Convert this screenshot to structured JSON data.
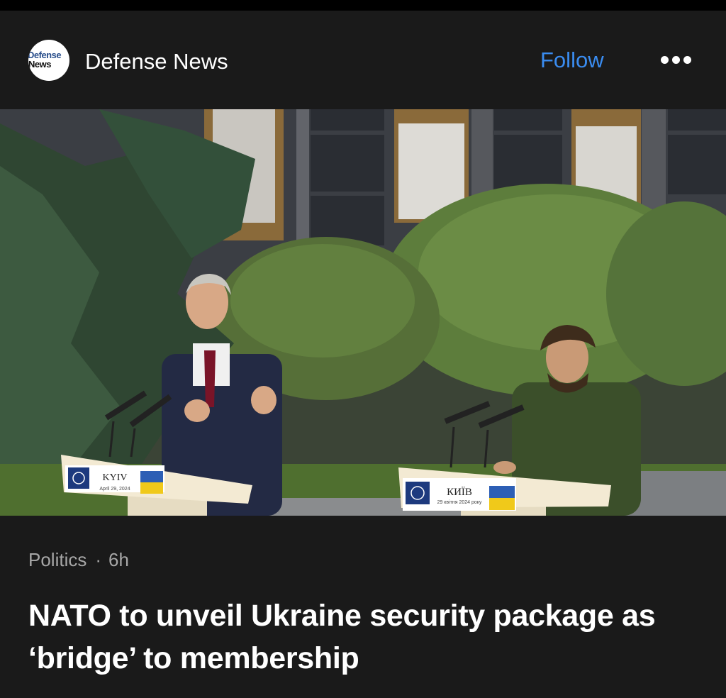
{
  "publisher": {
    "logo_line1": "Defense",
    "logo_line2": "News",
    "name": "Defense News",
    "follow_label": "Follow",
    "more_icon": "ellipsis-icon"
  },
  "photo": {
    "podium_left_label": "KYIV",
    "podium_left_date": "April 29, 2024",
    "podium_right_label": "КИЇВ",
    "podium_right_date": "29 квітня 2024 року"
  },
  "article": {
    "category": "Politics",
    "separator": "·",
    "age": "6h",
    "headline": "NATO to unveil Ukraine security package as ‘bridge’ to membership"
  },
  "colors": {
    "background": "#1a1a1a",
    "follow_blue": "#3a8cf0",
    "meta_gray": "#a7a7a7"
  }
}
